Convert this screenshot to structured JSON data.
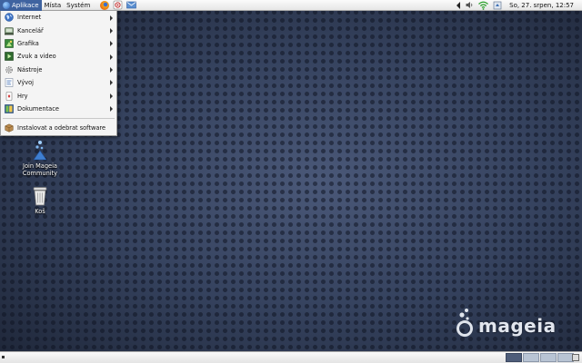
{
  "top_panel": {
    "menus": [
      {
        "label": "Aplikace",
        "active": true
      },
      {
        "label": "Místa",
        "active": false
      },
      {
        "label": "Systém",
        "active": false
      }
    ],
    "launchers": [
      "firefox-icon",
      "accessibility-icon",
      "mail-icon"
    ],
    "tray_icons": [
      "network-arrow-icon",
      "volume-icon",
      "wifi-icon",
      "update-icon"
    ],
    "clock": "So, 27. srpen, 12:57"
  },
  "app_menu": {
    "items": [
      {
        "label": "Internet",
        "icon": "globe-icon",
        "submenu": true
      },
      {
        "label": "Kancelář",
        "icon": "office-icon",
        "submenu": true
      },
      {
        "label": "Grafika",
        "icon": "graphics-icon",
        "submenu": true
      },
      {
        "label": "Zvuk a video",
        "icon": "multimedia-icon",
        "submenu": true
      },
      {
        "label": "Nástroje",
        "icon": "tools-icon",
        "submenu": true
      },
      {
        "label": "Vývoj",
        "icon": "development-icon",
        "submenu": true
      },
      {
        "label": "Hry",
        "icon": "games-icon",
        "submenu": true
      },
      {
        "label": "Dokumentace",
        "icon": "documentation-icon",
        "submenu": true
      }
    ],
    "install_item": {
      "label": "Instalovat a odebrat software",
      "icon": "package-icon"
    }
  },
  "desktop": {
    "icons": [
      {
        "label_line1": "Join Mageia",
        "label_line2": "Community",
        "icon": "mageia-community-icon"
      },
      {
        "label": "Koš",
        "icon": "trash-icon"
      }
    ],
    "brand": "mageia"
  },
  "bottom_panel": {
    "workspaces": 4,
    "active_workspace": 1
  },
  "colors": {
    "desktop_bg": "#2e3a52",
    "menu_highlight": "#3f63a0",
    "panel_bg": "#ececec"
  }
}
